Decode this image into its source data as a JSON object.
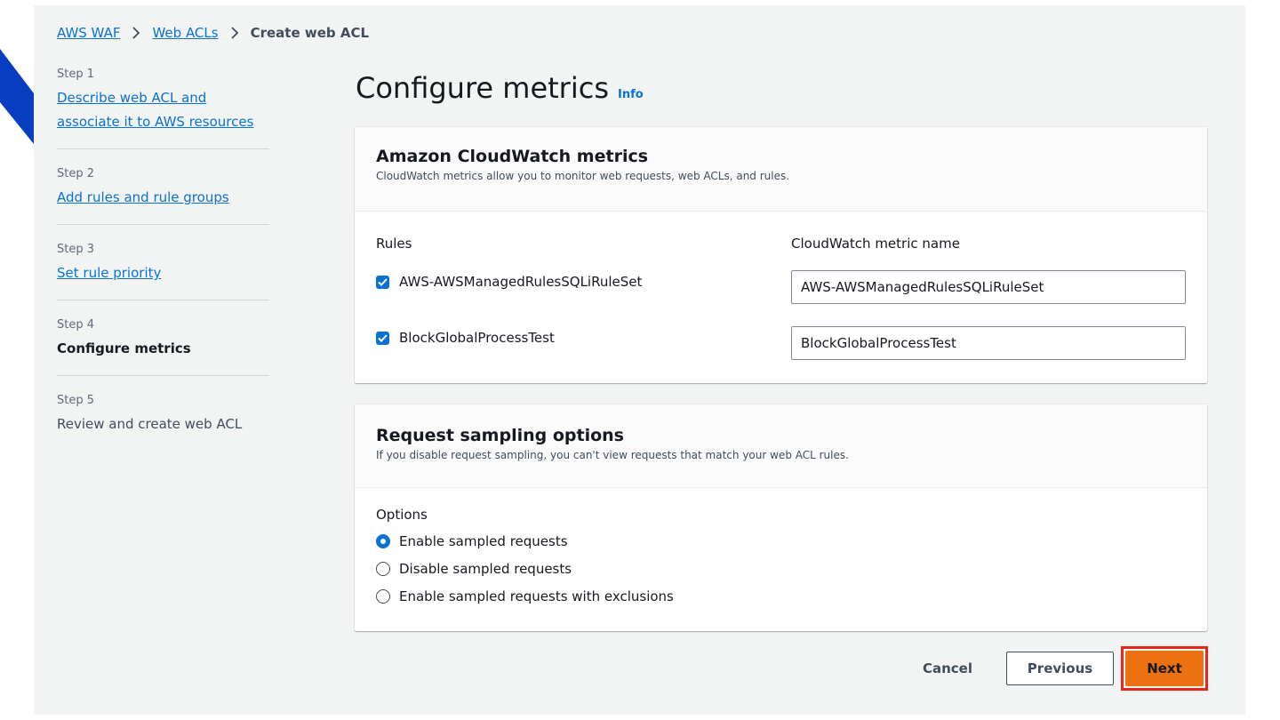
{
  "breadcrumb": {
    "items": [
      "AWS WAF",
      "Web ACLs"
    ],
    "current": "Create web ACL"
  },
  "steps": [
    {
      "number": "Step 1",
      "label": "Describe web ACL and associate it to AWS resources"
    },
    {
      "number": "Step 2",
      "label": "Add rules and rule groups"
    },
    {
      "number": "Step 3",
      "label": "Set rule priority"
    },
    {
      "number": "Step 4",
      "label": "Configure metrics"
    },
    {
      "number": "Step 5",
      "label": "Review and create web ACL"
    }
  ],
  "page": {
    "title": "Configure metrics",
    "info": "Info"
  },
  "metrics": {
    "title": "Amazon CloudWatch metrics",
    "description": "CloudWatch metrics allow you to monitor web requests, web ACLs, and rules.",
    "rules_label": "Rules",
    "metric_name_label": "CloudWatch metric name",
    "rules": [
      {
        "name": "AWS-AWSManagedRulesSQLiRuleSet",
        "metric": "AWS-AWSManagedRulesSQLiRuleSet",
        "checked": true
      },
      {
        "name": "BlockGlobalProcessTest",
        "metric": "BlockGlobalProcessTest",
        "checked": true
      }
    ]
  },
  "sampling": {
    "title": "Request sampling options",
    "description": "If you disable request sampling, you can't view requests that match your web ACL rules.",
    "options_label": "Options",
    "options": [
      {
        "label": "Enable sampled requests",
        "selected": true
      },
      {
        "label": "Disable sampled requests",
        "selected": false
      },
      {
        "label": "Enable sampled requests with exclusions",
        "selected": false
      }
    ]
  },
  "actions": {
    "cancel": "Cancel",
    "previous": "Previous",
    "next": "Next"
  },
  "colors": {
    "link": "#0972d3",
    "primary_button": "#ec7211",
    "highlight": "#e8261c",
    "background": "#f2f3f3",
    "corner_shape": "#0a3ec2"
  }
}
